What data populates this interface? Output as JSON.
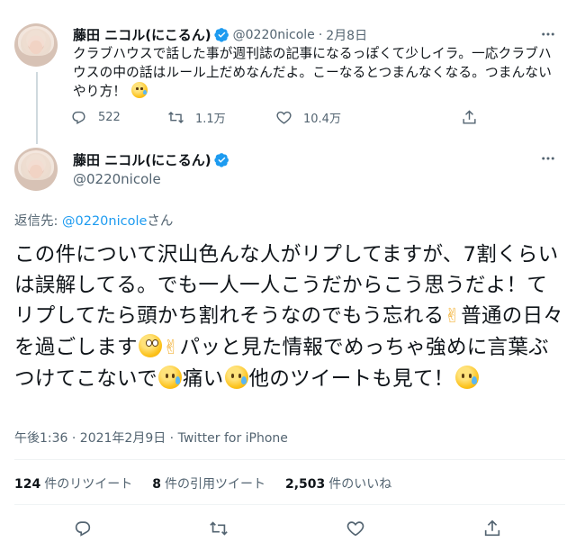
{
  "reply_tweet": {
    "author_name": "藤田 ニコル(にこるん)",
    "handle": "@0220nicole",
    "separator": "·",
    "date": "2月8日",
    "text": "クラブハウスで話した事が週刊誌の記事になるっぽくて少しイラ。一応クラブハウスの中の話はルール上だめなんだよ。こーなるとつまんなくなる。つまんないやり方！",
    "actions": {
      "reply_count": "522",
      "retweet_count": "1.1万",
      "like_count": "10.4万"
    }
  },
  "main_tweet": {
    "author_name": "藤田 ニコル(にこるん)",
    "handle": "@0220nicole",
    "replying_prefix": "返信先: ",
    "replying_handle": "@0220nicole",
    "replying_suffix": "さん",
    "text_segments": [
      "この件について沢山色んな人がリプしてますが、7割くらいは誤解してる。でも一人一人こうだからこう思うだよ！てリプしてたら頭かち割れそうなのでもう忘れる",
      "普通の日々を過ごします",
      "パッと見た情報でめっちゃ強めに言葉ぶつけてこないで",
      "痛い",
      "他のツイートも見て！"
    ],
    "meta": "午後1:36 · 2021年2月9日 · Twitter for iPhone",
    "stats": {
      "retweets_count": "124",
      "retweets_label": "件のリツイート",
      "quotes_count": "8",
      "quotes_label": "件の引用ツイート",
      "likes_count": "2,503",
      "likes_label": "件のいいね"
    }
  },
  "icons": {
    "verified": "verified-badge-icon",
    "more": "more-options-icon",
    "reply": "reply-icon",
    "retweet": "retweet-icon",
    "like": "like-icon",
    "share": "share-icon"
  },
  "colors": {
    "text": "#0f1419",
    "secondary": "#536471",
    "accent": "#1d9bf0",
    "divider": "#eff3f4"
  }
}
